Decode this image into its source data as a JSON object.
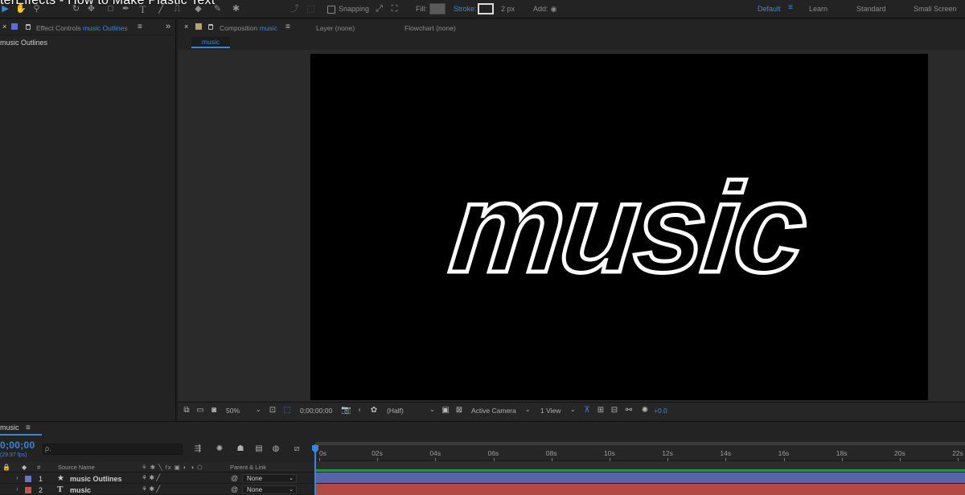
{
  "video_title": "terEffects - How to Make Plastic Text",
  "toolbar": {
    "snapping_label": "Snapping",
    "fill_label": "Fill:",
    "stroke_label": "Stroke:",
    "stroke_width": "2 px",
    "add_label": "Add:",
    "workspaces": [
      "Default",
      "Learn",
      "Standard",
      "Small Screen"
    ],
    "active_workspace": "Default"
  },
  "left_panel": {
    "tab_label": "Effect Controls",
    "tab_target": "music Outlines",
    "layer_name": "music Outlines"
  },
  "comp_panel": {
    "tab_label": "Composition",
    "tab_target": "music",
    "layer_tab": "Layer (none)",
    "flowchart_tab": "Flowchart (none)",
    "sub_tab": "music",
    "canvas_text": "music",
    "canvas_bg": "#000000"
  },
  "viewer_toolbar": {
    "zoom": "50%",
    "timecode": "0;00;00;00",
    "resolution": "(Half)",
    "camera": "Active Camera",
    "views": "1 View",
    "exposure": "+0.0"
  },
  "timeline": {
    "tab_label": "music",
    "timecode": "0;00;00",
    "fps": "(29.97 fps)",
    "search_placeholder": "ρ.",
    "columns": {
      "source_name": "Source Name",
      "parent_link": "Parent & Link"
    },
    "ruler_ticks": [
      "0s",
      "02s",
      "04s",
      "06s",
      "08s",
      "10s",
      "12s",
      "14s",
      "16s",
      "18s",
      "20s",
      "22s"
    ],
    "layers": [
      {
        "number": "1",
        "type_icon": "star-icon",
        "name": "music Outlines",
        "color": "#6a76c4",
        "parent": "None",
        "bar_color": "#5964a8"
      },
      {
        "number": "2",
        "type_icon": "text-layer-icon",
        "name": "music",
        "color": "#c2554f",
        "parent": "None",
        "bar_color": "#b14a45"
      }
    ]
  },
  "colors": {
    "accent": "#3b86d8",
    "panel_bg": "#232323",
    "work_area_green": "#2a8f4f"
  }
}
